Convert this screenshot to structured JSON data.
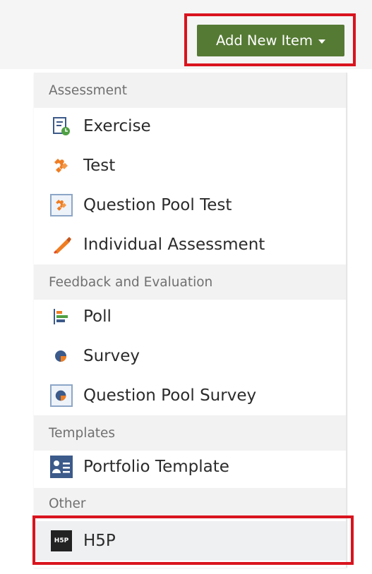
{
  "toolbar": {
    "add_button_label": "Add New Item"
  },
  "menu": {
    "sections": [
      {
        "title": "Assessment",
        "items": [
          {
            "label": "Exercise",
            "icon": "exercise-icon"
          },
          {
            "label": "Test",
            "icon": "test-puzzle-icon"
          },
          {
            "label": "Question Pool Test",
            "icon": "question-pool-test-icon"
          },
          {
            "label": "Individual Assessment",
            "icon": "individual-assessment-icon"
          }
        ]
      },
      {
        "title": "Feedback and Evaluation",
        "items": [
          {
            "label": "Poll",
            "icon": "poll-icon"
          },
          {
            "label": "Survey",
            "icon": "survey-icon"
          },
          {
            "label": "Question Pool Survey",
            "icon": "question-pool-survey-icon"
          }
        ]
      },
      {
        "title": "Templates",
        "items": [
          {
            "label": "Portfolio Template",
            "icon": "portfolio-template-icon"
          }
        ]
      },
      {
        "title": "Other",
        "items": [
          {
            "label": "H5P",
            "icon": "h5p-icon",
            "badge_text": "H5P",
            "highlighted": true
          }
        ]
      }
    ]
  },
  "colors": {
    "button_green": "#557a34",
    "highlight_red": "#d9141e",
    "section_bg": "#f2f2f2",
    "icon_orange": "#ef7d22",
    "icon_navy": "#3c5a8a"
  }
}
